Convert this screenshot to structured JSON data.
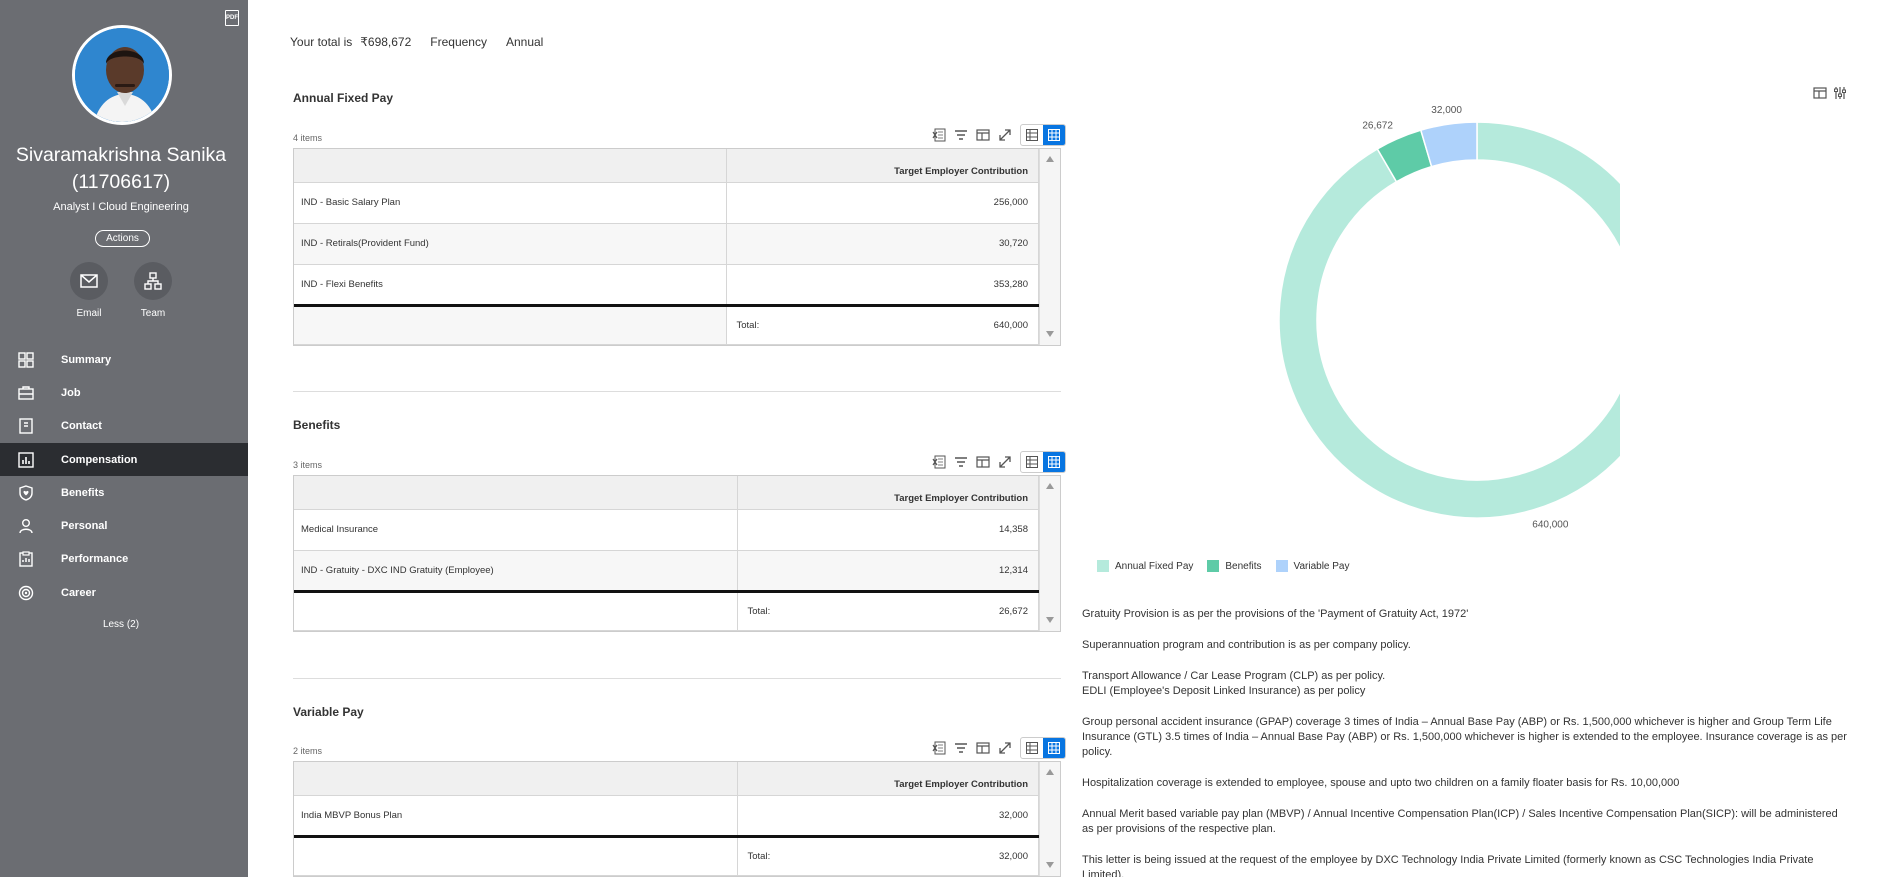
{
  "sidebar": {
    "pdf_label": "PDF",
    "employee_name": "Sivaramakrishna Sanika (11706617)",
    "employee_role": "Analyst I Cloud Engineering",
    "actions_label": "Actions",
    "quick_actions": [
      {
        "label": "Email",
        "icon": "envelope-icon"
      },
      {
        "label": "Team",
        "icon": "org-chart-icon"
      }
    ],
    "nav": [
      {
        "label": "Summary",
        "icon": "summary-icon",
        "active": false
      },
      {
        "label": "Job",
        "icon": "briefcase-icon",
        "active": false
      },
      {
        "label": "Contact",
        "icon": "contact-icon",
        "active": false
      },
      {
        "label": "Compensation",
        "icon": "compensation-icon",
        "active": true
      },
      {
        "label": "Benefits",
        "icon": "shield-icon",
        "active": false
      },
      {
        "label": "Personal",
        "icon": "person-icon",
        "active": false
      },
      {
        "label": "Performance",
        "icon": "clipboard-icon",
        "active": false
      },
      {
        "label": "Career",
        "icon": "target-icon",
        "active": false
      }
    ],
    "less_label": "Less (2)"
  },
  "summary": {
    "total_label": "Your total is",
    "total_value": "₹698,672",
    "frequency_label": "Frequency",
    "frequency_value": "Annual"
  },
  "sections": [
    {
      "title": "Annual Fixed Pay",
      "count": "4 items",
      "column_header": "Target Employer Contribution",
      "rows": [
        {
          "name": "IND - Basic Salary Plan",
          "value": "256,000"
        },
        {
          "name": "IND - Retirals(Provident Fund)",
          "value": "30,720"
        },
        {
          "name": "IND - Flexi Benefits",
          "value": "353,280"
        }
      ],
      "total_label": "Total:",
      "total_value": "640,000"
    },
    {
      "title": "Benefits",
      "count": "3 items",
      "column_header": "Target Employer Contribution",
      "rows": [
        {
          "name": "Medical Insurance",
          "value": "14,358"
        },
        {
          "name": "IND - Gratuity - DXC IND Gratuity (Employee)",
          "value": "12,314"
        }
      ],
      "total_label": "Total:",
      "total_value": "26,672"
    },
    {
      "title": "Variable Pay",
      "count": "2 items",
      "column_header": "Target Employer Contribution",
      "rows": [
        {
          "name": "India MBVP Bonus Plan",
          "value": "32,000"
        }
      ],
      "total_label": "Total:",
      "total_value": "32,000"
    }
  ],
  "chart_data": {
    "type": "pie",
    "categories": [
      "Annual Fixed Pay",
      "Benefits",
      "Variable Pay"
    ],
    "values": [
      640000,
      26672,
      32000
    ],
    "data_labels": [
      "640,000",
      "26,672",
      "32,000"
    ],
    "colors": [
      "#b5eadc",
      "#5ecba7",
      "#aed2fb"
    ],
    "donut": true,
    "legend_position": "bottom-left"
  },
  "notes": [
    "Gratuity Provision is as per the provisions of the 'Payment of Gratuity Act, 1972'",
    "Superannuation program and contribution is as per company policy.",
    "Transport Allowance / Car Lease Program (CLP) as per policy.\nEDLI (Employee's Deposit Linked Insurance) as per policy",
    "Group personal accident insurance (GPAP) coverage 3 times of India – Annual Base Pay (ABP) or Rs. 1,500,000 whichever is higher and Group Term Life Insurance (GTL) 3.5 times of India – Annual Base Pay (ABP) or Rs. 1,500,000 whichever is higher is extended to the employee. Insurance coverage is as per policy.",
    "Hospitalization coverage is extended to employee, spouse and upto two children on a family floater basis for Rs. 10,00,000",
    "Annual Merit based variable pay plan (MBVP) / Annual Incentive Compensation Plan(ICP) / Sales Incentive Compensation Plan(SICP): will be administered as per provisions of the respective plan.",
    "This letter is being issued at the request of the employee by DXC Technology India Private Limited (formerly known as CSC Technologies India Private Limited)."
  ]
}
